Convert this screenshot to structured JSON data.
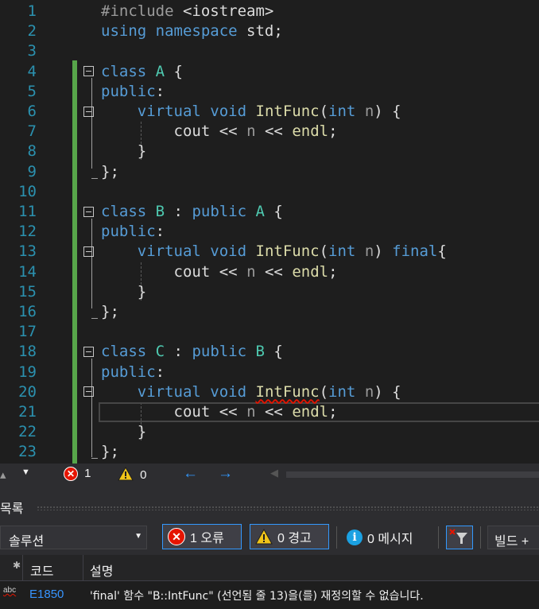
{
  "editor": {
    "line_numbers": [
      "1",
      "2",
      "3",
      "4",
      "5",
      "6",
      "7",
      "8",
      "9",
      "10",
      "11",
      "12",
      "13",
      "14",
      "15",
      "16",
      "17",
      "18",
      "19",
      "20",
      "21",
      "22",
      "23"
    ],
    "lines": [
      [
        {
          "t": "#include ",
          "c": "pp"
        },
        {
          "t": "<iostream>",
          "c": "cb"
        }
      ],
      [
        {
          "t": "using",
          "c": "kw"
        },
        {
          "t": " ",
          "c": ""
        },
        {
          "t": "namespace",
          "c": "kw"
        },
        {
          "t": " std;",
          "c": ""
        }
      ],
      [],
      [
        {
          "t": "class",
          "c": "kw"
        },
        {
          "t": " ",
          "c": ""
        },
        {
          "t": "A",
          "c": "ty"
        },
        {
          "t": " {",
          "c": ""
        }
      ],
      [
        {
          "t": "public",
          "c": "kw"
        },
        {
          "t": ":",
          "c": ""
        }
      ],
      [
        {
          "t": "    ",
          "c": ""
        },
        {
          "t": "virtual",
          "c": "kw"
        },
        {
          "t": " ",
          "c": ""
        },
        {
          "t": "void",
          "c": "kw"
        },
        {
          "t": " ",
          "c": ""
        },
        {
          "t": "IntFunc",
          "c": "fn"
        },
        {
          "t": "(",
          "c": ""
        },
        {
          "t": "int",
          "c": "kw"
        },
        {
          "t": " ",
          "c": ""
        },
        {
          "t": "n",
          "c": "pa"
        },
        {
          "t": ") {",
          "c": ""
        }
      ],
      [
        {
          "t": "        cout ",
          "c": ""
        },
        {
          "t": "<<",
          "c": "cb"
        },
        {
          "t": " ",
          "c": ""
        },
        {
          "t": "n",
          "c": "pa"
        },
        {
          "t": " ",
          "c": ""
        },
        {
          "t": "<<",
          "c": "cb"
        },
        {
          "t": " ",
          "c": ""
        },
        {
          "t": "endl",
          "c": "fn"
        },
        {
          "t": ";",
          "c": ""
        }
      ],
      [
        {
          "t": "    }",
          "c": ""
        }
      ],
      [
        {
          "t": "};",
          "c": ""
        }
      ],
      [],
      [
        {
          "t": "class",
          "c": "kw"
        },
        {
          "t": " ",
          "c": ""
        },
        {
          "t": "B",
          "c": "ty"
        },
        {
          "t": " : ",
          "c": ""
        },
        {
          "t": "public",
          "c": "kw"
        },
        {
          "t": " ",
          "c": ""
        },
        {
          "t": "A",
          "c": "ty"
        },
        {
          "t": " {",
          "c": ""
        }
      ],
      [
        {
          "t": "public",
          "c": "kw"
        },
        {
          "t": ":",
          "c": ""
        }
      ],
      [
        {
          "t": "    ",
          "c": ""
        },
        {
          "t": "virtual",
          "c": "kw"
        },
        {
          "t": " ",
          "c": ""
        },
        {
          "t": "void",
          "c": "kw"
        },
        {
          "t": " ",
          "c": ""
        },
        {
          "t": "IntFunc",
          "c": "fn"
        },
        {
          "t": "(",
          "c": ""
        },
        {
          "t": "int",
          "c": "kw"
        },
        {
          "t": " ",
          "c": ""
        },
        {
          "t": "n",
          "c": "pa"
        },
        {
          "t": ") ",
          "c": ""
        },
        {
          "t": "final",
          "c": "kw"
        },
        {
          "t": "{",
          "c": ""
        }
      ],
      [
        {
          "t": "        cout ",
          "c": ""
        },
        {
          "t": "<<",
          "c": "cb"
        },
        {
          "t": " ",
          "c": ""
        },
        {
          "t": "n",
          "c": "pa"
        },
        {
          "t": " ",
          "c": ""
        },
        {
          "t": "<<",
          "c": "cb"
        },
        {
          "t": " ",
          "c": ""
        },
        {
          "t": "endl",
          "c": "fn"
        },
        {
          "t": ";",
          "c": ""
        }
      ],
      [
        {
          "t": "    }",
          "c": ""
        }
      ],
      [
        {
          "t": "};",
          "c": ""
        }
      ],
      [],
      [
        {
          "t": "class",
          "c": "kw"
        },
        {
          "t": " ",
          "c": ""
        },
        {
          "t": "C",
          "c": "ty"
        },
        {
          "t": " : ",
          "c": ""
        },
        {
          "t": "public",
          "c": "kw"
        },
        {
          "t": " ",
          "c": ""
        },
        {
          "t": "B",
          "c": "ty"
        },
        {
          "t": " {",
          "c": ""
        }
      ],
      [
        {
          "t": "public",
          "c": "kw"
        },
        {
          "t": ":",
          "c": ""
        }
      ],
      [
        {
          "t": "    ",
          "c": ""
        },
        {
          "t": "virtual",
          "c": "kw"
        },
        {
          "t": " ",
          "c": ""
        },
        {
          "t": "void",
          "c": "kw"
        },
        {
          "t": " ",
          "c": ""
        },
        {
          "t": "IntFunc",
          "c": "fn wavy"
        },
        {
          "t": "(",
          "c": ""
        },
        {
          "t": "int",
          "c": "kw"
        },
        {
          "t": " ",
          "c": ""
        },
        {
          "t": "n",
          "c": "pa"
        },
        {
          "t": ") {",
          "c": ""
        }
      ],
      [
        {
          "t": "        cout ",
          "c": ""
        },
        {
          "t": "<<",
          "c": "cb"
        },
        {
          "t": " ",
          "c": ""
        },
        {
          "t": "n",
          "c": "pa"
        },
        {
          "t": " ",
          "c": ""
        },
        {
          "t": "<<",
          "c": "cb"
        },
        {
          "t": " ",
          "c": ""
        },
        {
          "t": "endl",
          "c": "fn"
        },
        {
          "t": ";",
          "c": ""
        }
      ],
      [
        {
          "t": "    }",
          "c": ""
        }
      ],
      [
        {
          "t": "};",
          "c": ""
        }
      ]
    ]
  },
  "status_bar": {
    "errors": "1",
    "warnings": "0"
  },
  "error_panel": {
    "title": "목록",
    "scope": "솔루션",
    "errors_label": "1 오류",
    "warnings_label": "0 경고",
    "messages_label": "0 메시지",
    "build_label": "빌드 +",
    "columns": {
      "code": "코드",
      "description": "설명"
    },
    "rows": [
      {
        "icon": "abc",
        "code": "E1850",
        "description": "'final' 함수 \"B::IntFunc\" (선언됨 줄 13)을(를) 재정의할 수 없습니다."
      }
    ]
  },
  "colors": {
    "keyword": "#569cd6",
    "type": "#4ec9b0",
    "function": "#dcdcaa",
    "line_number": "#2b91af",
    "change_bar": "#57a64a",
    "error": "#e51400"
  }
}
